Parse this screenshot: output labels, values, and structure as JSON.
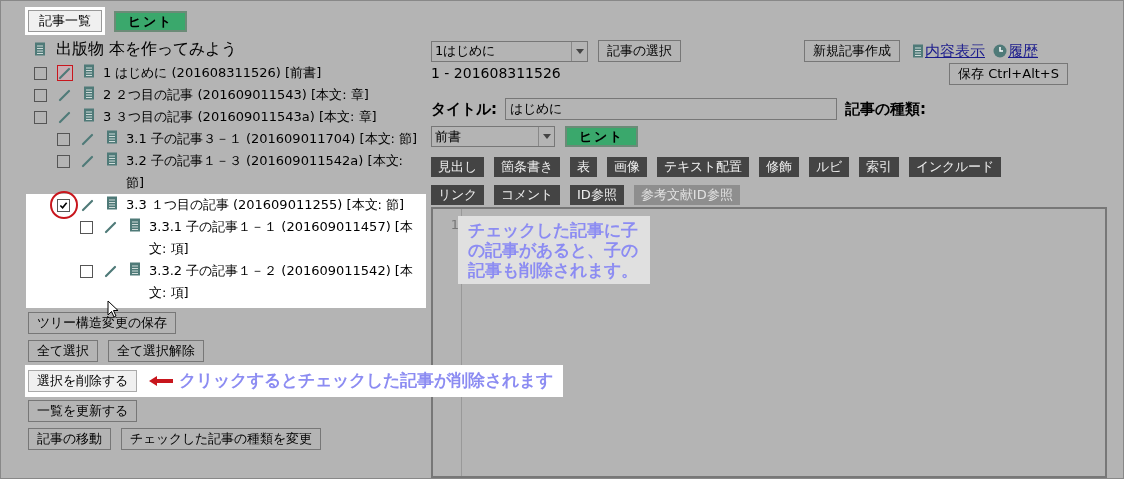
{
  "top_buttons": [
    {
      "label": "記事一覧",
      "kind": "plain",
      "highlighted": true
    },
    {
      "label": "ヒント",
      "kind": "hint",
      "highlighted": false
    }
  ],
  "publication": {
    "title": "出版物 本を作ってみよう"
  },
  "tree": [
    {
      "label": "1 はじめに (201608311526) [前書]",
      "checked": false,
      "current": true,
      "highlighted": false,
      "circled": false
    },
    {
      "label": "2 ２つ目の記事 (201609011543) [本文: 章]",
      "checked": false,
      "current": false,
      "highlighted": false,
      "circled": false
    },
    {
      "label": "3 ３つ目の記事 (201609011543a) [本文: 章]",
      "checked": false,
      "current": false,
      "highlighted": false,
      "circled": false,
      "children": [
        {
          "label": "3.1 子の記事３－１ (201609011704) [本文: 節]",
          "checked": false,
          "current": false,
          "highlighted": false,
          "circled": false
        },
        {
          "label": "3.2 子の記事１－３ (201609011542a) [本文: 節]",
          "checked": false,
          "current": false,
          "highlighted": false,
          "circled": false
        },
        {
          "label": "3.3 １つ目の記事 (201609011255) [本文: 節]",
          "checked": true,
          "current": false,
          "highlighted": true,
          "circled": true,
          "children": [
            {
              "label": "3.3.1 子の記事１－１ (201609011457) [本文: 項]",
              "checked": false,
              "current": false,
              "highlighted": false,
              "circled": false
            },
            {
              "label": "3.3.2 子の記事１－２ (201609011542) [本文: 項]",
              "checked": false,
              "current": false,
              "highlighted": false,
              "circled": false
            }
          ]
        }
      ]
    }
  ],
  "action_rows": [
    [
      {
        "label": "ツリー構造変更の保存"
      }
    ],
    [
      {
        "label": "全て選択"
      },
      {
        "label": "全て選択解除"
      }
    ],
    [
      {
        "label": "選択を削除する",
        "callout": "クリックするとチェックした記事が削除されます"
      }
    ],
    [
      {
        "label": "一覧を更新する"
      }
    ],
    [
      {
        "label": "記事の移動"
      },
      {
        "label": "チェックした記事の種類を変更"
      }
    ]
  ],
  "article_select": {
    "value": "1はじめに",
    "button": "記事の選択"
  },
  "new_article_button": "新規記事作成",
  "links": [
    {
      "label": "内容表示",
      "kind": "document"
    },
    {
      "label": "履歴",
      "kind": "history"
    }
  ],
  "article_id": "1 - 201608311526",
  "save_button": "保存 Ctrl+Alt+S",
  "title_field": {
    "label": "タイトル:",
    "value": "はじめに"
  },
  "type_label": "記事の種類:",
  "type_select": {
    "value": "前書",
    "hint_button": "ヒント"
  },
  "toolbar": [
    [
      {
        "label": "見出し",
        "disabled": false
      },
      {
        "label": "箇条書き",
        "disabled": false
      },
      {
        "label": "表",
        "disabled": false
      },
      {
        "label": "画像",
        "disabled": false
      },
      {
        "label": "テキスト配置",
        "disabled": false
      },
      {
        "label": "修飾",
        "disabled": false
      },
      {
        "label": "ルビ",
        "disabled": false
      },
      {
        "label": "索引",
        "disabled": false
      },
      {
        "label": "インクルード",
        "disabled": false
      }
    ],
    [
      {
        "label": "リンク",
        "disabled": false
      },
      {
        "label": "コメント",
        "disabled": false
      },
      {
        "label": "ID参照",
        "disabled": false
      },
      {
        "label": "参考文献ID参照",
        "disabled": true
      }
    ]
  ],
  "editor": {
    "line_number": "1",
    "callout": "チェックした記事に子の記事があると、子の記事も削除されます。"
  }
}
